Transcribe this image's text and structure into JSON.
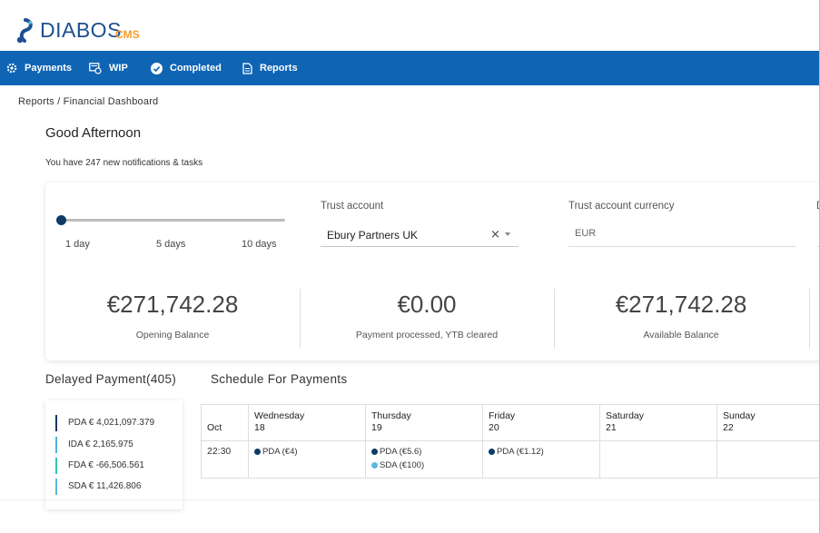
{
  "app": {
    "logo_text": "DIABOS",
    "logo_sub": "CMS",
    "brand_color": "#0f64b4",
    "accent_color": "#f29c2b"
  },
  "nav": {
    "items": [
      {
        "label": "Payments",
        "icon": "gear-icon"
      },
      {
        "label": "WIP",
        "icon": "wip-icon"
      },
      {
        "label": "Completed",
        "icon": "check-circle-icon"
      },
      {
        "label": "Reports",
        "icon": "document-icon"
      }
    ]
  },
  "breadcrumb": "Reports / Financial Dashboard",
  "greeting": "Good Afternoon",
  "notifications": "You have 247 new notifications & tasks",
  "filters": {
    "slider": {
      "labels": [
        "1 day",
        "5 days",
        "10 days"
      ],
      "selected": "1 day"
    },
    "trust_account": {
      "label": "Trust account",
      "value": "Ebury Partners UK",
      "clear": "×"
    },
    "currency": {
      "label": "Trust account currency",
      "value": "EUR"
    },
    "cut_label": "D"
  },
  "stats": [
    {
      "amount": "€271,742.28",
      "label": "Opening Balance"
    },
    {
      "amount": "€0.00",
      "label": "Payment processed, YTB cleared"
    },
    {
      "amount": "€271,742.28",
      "label": "Available Balance"
    }
  ],
  "delayed": {
    "title": "Delayed Payment(405)",
    "items": [
      {
        "text": "PDA € 4,021,097.379",
        "color": "#0d3b66"
      },
      {
        "text": "IDA € 2,165.975",
        "color": "#4fb3d9"
      },
      {
        "text": "FDA € -66,506.561",
        "color": "#2ec4b6"
      },
      {
        "text": "SDA € 11,426.806",
        "color": "#5bb8e0"
      }
    ]
  },
  "schedule": {
    "title": "Schedule For Payments",
    "month": "Oct",
    "time": "22:30",
    "days": [
      {
        "day": "Wednesday",
        "date": "18",
        "events": [
          {
            "text": "PDA (€4)",
            "color": "#0d3b66"
          }
        ]
      },
      {
        "day": "Thursday",
        "date": "19",
        "events": [
          {
            "text": "PDA (€5.6)",
            "color": "#0d3b66"
          },
          {
            "text": "SDA (€100)",
            "color": "#5bb8e0"
          }
        ]
      },
      {
        "day": "Friday",
        "date": "20",
        "events": [
          {
            "text": "PDA (€1.12)",
            "color": "#0d3b66"
          }
        ]
      },
      {
        "day": "Saturday",
        "date": "21",
        "events": []
      },
      {
        "day": "Sunday",
        "date": "22",
        "events": []
      }
    ]
  }
}
